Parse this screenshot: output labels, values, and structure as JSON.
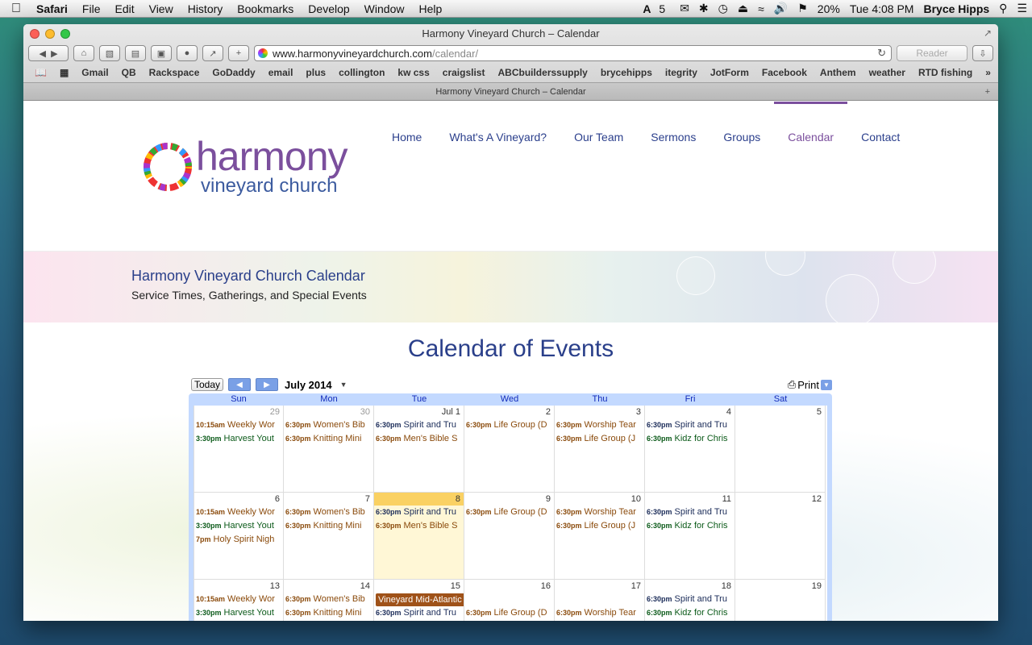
{
  "menubar": {
    "app": "Safari",
    "items": [
      "File",
      "Edit",
      "View",
      "History",
      "Bookmarks",
      "Develop",
      "Window",
      "Help"
    ],
    "status": {
      "adobe": "5",
      "battery": "20%",
      "clock": "Tue 4:08 PM",
      "user": "Bryce Hipps"
    }
  },
  "window": {
    "title": "Harmony Vineyard Church – Calendar",
    "url_host": "www.harmonyvineyardchurch.com",
    "url_path": "/calendar/",
    "reader_label": "Reader",
    "bookmarks": [
      "Gmail",
      "QB",
      "Rackspace",
      "GoDaddy",
      "email",
      "plus",
      "collington",
      "kw css",
      "craigslist",
      "ABCbuilderssupply",
      "brycehipps",
      "itegrity",
      "JotForm",
      "Facebook",
      "Anthem",
      "weather",
      "RTD fishing"
    ],
    "tab_title": "Harmony Vineyard Church – Calendar"
  },
  "site": {
    "logo_line1": "harmony",
    "logo_line2": "vineyard church",
    "nav": [
      "Home",
      "What's A Vineyard?",
      "Our Team",
      "Sermons",
      "Groups",
      "Calendar",
      "Contact"
    ],
    "nav_active": "Calendar",
    "banner_title": "Harmony Vineyard Church Calendar",
    "banner_subtitle": "Service Times, Gatherings, and Special Events",
    "page_title": "Calendar of Events"
  },
  "calendar": {
    "today_label": "Today",
    "month": "July 2014",
    "print_label": "Print",
    "weekdays": [
      "Sun",
      "Mon",
      "Tue",
      "Wed",
      "Thu",
      "Fri",
      "Sat"
    ],
    "weeks": [
      {
        "days": [
          {
            "num": "29",
            "other": true,
            "events": [
              {
                "t": "10:15am",
                "n": "Weekly Wor",
                "c": "c1"
              },
              {
                "t": "3:30pm",
                "n": "Harvest Yout",
                "c": "c2"
              }
            ]
          },
          {
            "num": "30",
            "other": true,
            "events": [
              {
                "t": "6:30pm",
                "n": "Women's Bib",
                "c": "c1"
              },
              {
                "t": "6:30pm",
                "n": "Knitting Mini",
                "c": "c1"
              }
            ]
          },
          {
            "num": "Jul 1",
            "events": [
              {
                "t": "6:30pm",
                "n": "Spirit and Tru",
                "c": "c3"
              },
              {
                "t": "6:30pm",
                "n": "Men's Bible S",
                "c": "c1"
              }
            ]
          },
          {
            "num": "2",
            "events": [
              {
                "t": "6:30pm",
                "n": "Life Group (D",
                "c": "c1"
              }
            ]
          },
          {
            "num": "3",
            "events": [
              {
                "t": "6:30pm",
                "n": "Worship Tear",
                "c": "c1"
              },
              {
                "t": "6:30pm",
                "n": "Life Group (J",
                "c": "c1"
              }
            ]
          },
          {
            "num": "4",
            "events": [
              {
                "t": "6:30pm",
                "n": "Spirit and Tru",
                "c": "c3"
              },
              {
                "t": "6:30pm",
                "n": "Kidz for Chris",
                "c": "c2"
              }
            ]
          },
          {
            "num": "5",
            "events": []
          }
        ]
      },
      {
        "days": [
          {
            "num": "6",
            "events": [
              {
                "t": "10:15am",
                "n": "Weekly Wor",
                "c": "c1"
              },
              {
                "t": "3:30pm",
                "n": "Harvest Yout",
                "c": "c2"
              },
              {
                "t": "7pm",
                "n": "Holy Spirit Nigh",
                "c": "c1"
              }
            ]
          },
          {
            "num": "7",
            "events": [
              {
                "t": "6:30pm",
                "n": "Women's Bib",
                "c": "c1"
              },
              {
                "t": "6:30pm",
                "n": "Knitting Mini",
                "c": "c1"
              }
            ]
          },
          {
            "num": "8",
            "today": true,
            "events": [
              {
                "t": "6:30pm",
                "n": "Spirit and Tru",
                "c": "c3"
              },
              {
                "t": "6:30pm",
                "n": "Men's Bible S",
                "c": "c1"
              }
            ]
          },
          {
            "num": "9",
            "events": [
              {
                "t": "6:30pm",
                "n": "Life Group (D",
                "c": "c1"
              }
            ]
          },
          {
            "num": "10",
            "events": [
              {
                "t": "6:30pm",
                "n": "Worship Tear",
                "c": "c1"
              },
              {
                "t": "6:30pm",
                "n": "Life Group (J",
                "c": "c1"
              }
            ]
          },
          {
            "num": "11",
            "events": [
              {
                "t": "6:30pm",
                "n": "Spirit and Tru",
                "c": "c3"
              },
              {
                "t": "6:30pm",
                "n": "Kidz for Chris",
                "c": "c2"
              }
            ]
          },
          {
            "num": "12",
            "events": []
          }
        ]
      },
      {
        "days": [
          {
            "num": "13",
            "events": [
              {
                "t": "10:15am",
                "n": "Weekly Wor",
                "c": "c1"
              },
              {
                "t": "3:30pm",
                "n": "Harvest Yout",
                "c": "c2"
              }
            ]
          },
          {
            "num": "14",
            "events": [
              {
                "t": "6:30pm",
                "n": "Women's Bib",
                "c": "c1"
              },
              {
                "t": "6:30pm",
                "n": "Knitting Mini",
                "c": "c1"
              }
            ]
          },
          {
            "num": "15",
            "multi": "Vineyard Mid-Atlantic Regional Conference",
            "events": [
              {
                "t": "",
                "n": "",
                "c": "c1"
              },
              {
                "t": "6:30pm",
                "n": "Spirit and Tru",
                "c": "c3"
              }
            ]
          },
          {
            "num": "16",
            "events": [
              {
                "t": "",
                "n": "",
                "c": "c1"
              },
              {
                "t": "6:30pm",
                "n": "Life Group (D",
                "c": "c1"
              }
            ]
          },
          {
            "num": "17",
            "events": [
              {
                "t": "",
                "n": "",
                "c": "c1"
              },
              {
                "t": "6:30pm",
                "n": "Worship Tear",
                "c": "c1"
              }
            ]
          },
          {
            "num": "18",
            "events": [
              {
                "t": "6:30pm",
                "n": "Spirit and Tru",
                "c": "c3"
              },
              {
                "t": "6:30pm",
                "n": "Kidz for Chris",
                "c": "c2"
              }
            ]
          },
          {
            "num": "19",
            "events": []
          }
        ]
      }
    ]
  }
}
